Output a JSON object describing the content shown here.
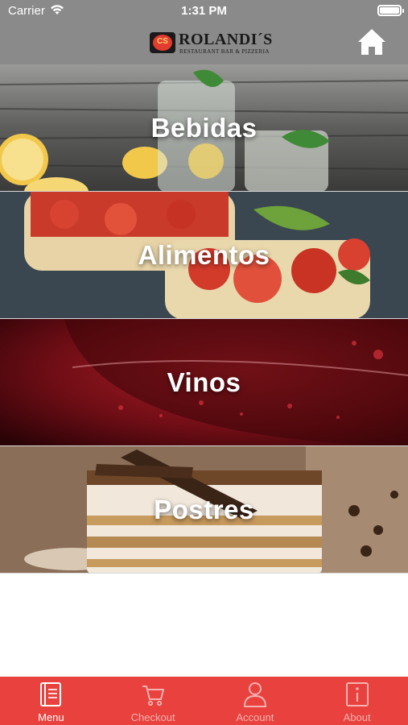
{
  "status_bar": {
    "carrier": "Carrier",
    "time": "1:31 PM"
  },
  "header": {
    "logo_badge": "CS",
    "logo_name": "ROLANDI´S",
    "logo_sub": "RESTAURANT BAR & PIZZERIA",
    "home_icon": "home-icon",
    "background_color": "#8a8a8a"
  },
  "categories": [
    {
      "label": "Bebidas"
    },
    {
      "label": "Alimentos"
    },
    {
      "label": "Vinos"
    },
    {
      "label": "Postres"
    }
  ],
  "tabbar": {
    "background_color": "#e8413e",
    "tabs": [
      {
        "label": "Menu",
        "icon": "menu-book-icon",
        "active": true
      },
      {
        "label": "Checkout",
        "icon": "cart-icon",
        "active": false
      },
      {
        "label": "Account",
        "icon": "person-icon",
        "active": false
      },
      {
        "label": "About",
        "icon": "info-icon",
        "active": false
      }
    ]
  }
}
